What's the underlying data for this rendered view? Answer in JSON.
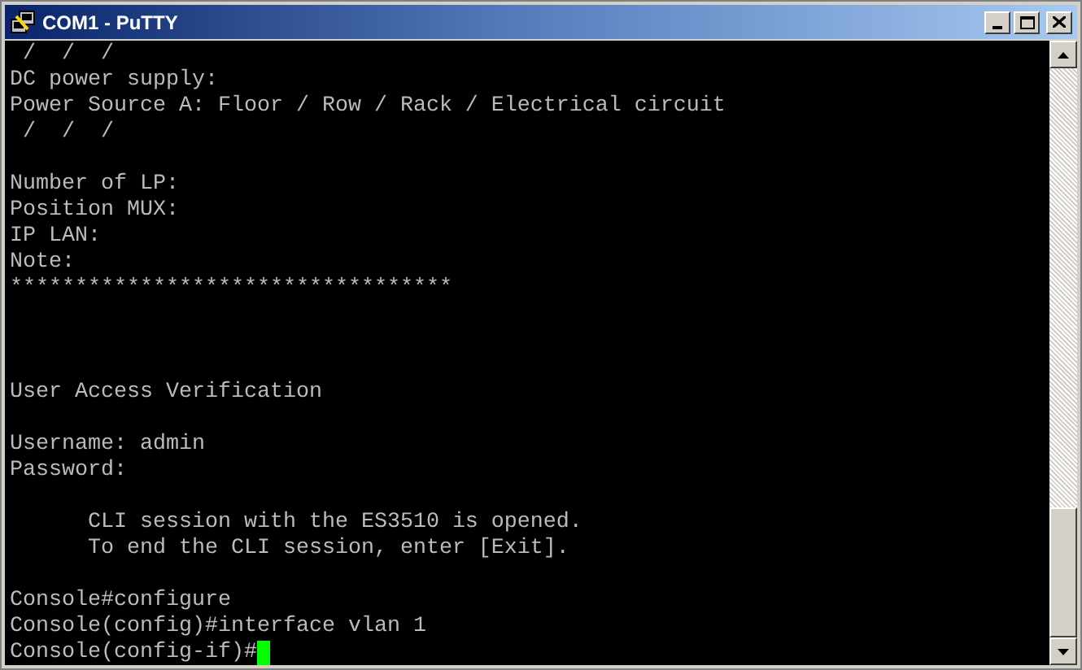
{
  "window": {
    "title": "COM1 - PuTTY"
  },
  "terminal": {
    "lines": [
      {
        "kind": "text",
        "text": " /  /  /"
      },
      {
        "kind": "text",
        "text": "DC power supply:"
      },
      {
        "kind": "text",
        "text": "Power Source A: Floor / Row / Rack / Electrical circuit"
      },
      {
        "kind": "text",
        "text": " /  /  /"
      },
      {
        "kind": "blank"
      },
      {
        "kind": "text",
        "text": "Number of LP:"
      },
      {
        "kind": "text",
        "text": "Position MUX:"
      },
      {
        "kind": "text",
        "text": "IP LAN:"
      },
      {
        "kind": "text",
        "text": "Note:"
      },
      {
        "kind": "text",
        "text": "**********************************"
      },
      {
        "kind": "blank"
      },
      {
        "kind": "blank"
      },
      {
        "kind": "blank"
      },
      {
        "kind": "text",
        "text": "User Access Verification"
      },
      {
        "kind": "blank"
      },
      {
        "kind": "text",
        "text": "Username: admin"
      },
      {
        "kind": "text",
        "text": "Password:"
      },
      {
        "kind": "blank"
      },
      {
        "kind": "text",
        "text": "      CLI session with the ES3510 is opened."
      },
      {
        "kind": "text",
        "text": "      To end the CLI session, enter [Exit]."
      },
      {
        "kind": "blank"
      },
      {
        "kind": "text",
        "text": "Console#configure"
      },
      {
        "kind": "text",
        "text": "Console(config)#interface vlan 1"
      },
      {
        "kind": "prompt",
        "text": "Console(config-if)#",
        "cursor": true
      }
    ]
  }
}
